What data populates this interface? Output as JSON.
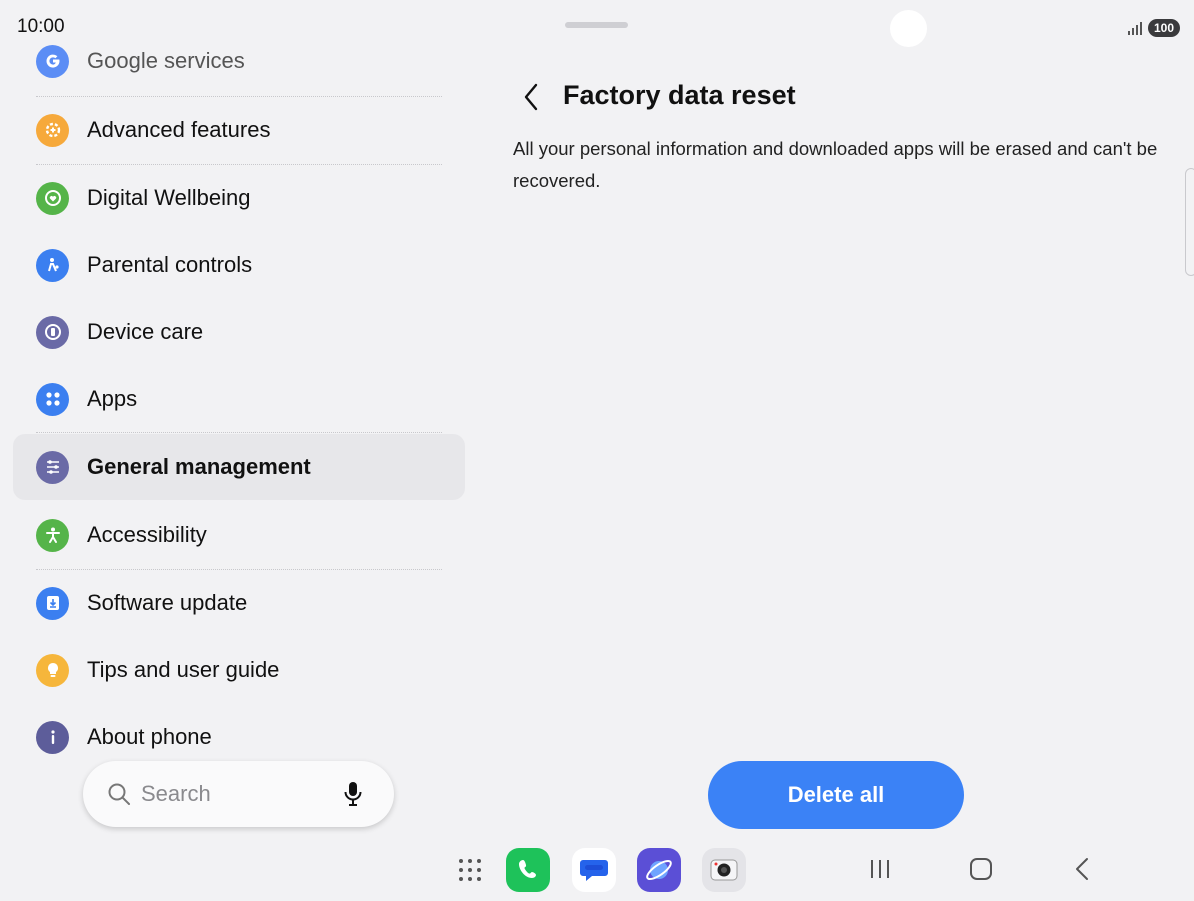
{
  "status_bar": {
    "time": "10:00",
    "battery": "100"
  },
  "settings_list": {
    "items": [
      {
        "label": "Google services",
        "icon": "google-icon",
        "color": "#5b8df5"
      },
      {
        "label": "Advanced features",
        "icon": "gear-plus-icon",
        "color": "#f6a93b"
      },
      {
        "label": "Digital Wellbeing",
        "icon": "heart-ring-icon",
        "color": "#55b449"
      },
      {
        "label": "Parental controls",
        "icon": "family-icon",
        "color": "#3b7ff0"
      },
      {
        "label": "Device care",
        "icon": "device-care-icon",
        "color": "#6a6aa6"
      },
      {
        "label": "Apps",
        "icon": "apps-grid-icon",
        "color": "#3b7ff0"
      },
      {
        "label": "General management",
        "icon": "sliders-icon",
        "color": "#6a6aa6"
      },
      {
        "label": "Accessibility",
        "icon": "accessibility-icon",
        "color": "#55b449"
      },
      {
        "label": "Software update",
        "icon": "download-icon",
        "color": "#3b7ff0"
      },
      {
        "label": "Tips and user guide",
        "icon": "lightbulb-icon",
        "color": "#f6b63b"
      },
      {
        "label": "About phone",
        "icon": "info-icon",
        "color": "#5d5d9a"
      }
    ],
    "selected": "General management"
  },
  "search": {
    "placeholder": "Search"
  },
  "detail": {
    "title": "Factory data reset",
    "description": "All your personal information and downloaded apps will be erased and can't be recovered.",
    "delete_button": "Delete all"
  },
  "dock": {
    "apps": [
      "phone-icon",
      "messages-icon",
      "internet-icon",
      "camera-icon"
    ]
  },
  "colors": {
    "accent": "#3b82f6",
    "background": "#f2f2f4",
    "selected_row": "#e7e7ea"
  }
}
